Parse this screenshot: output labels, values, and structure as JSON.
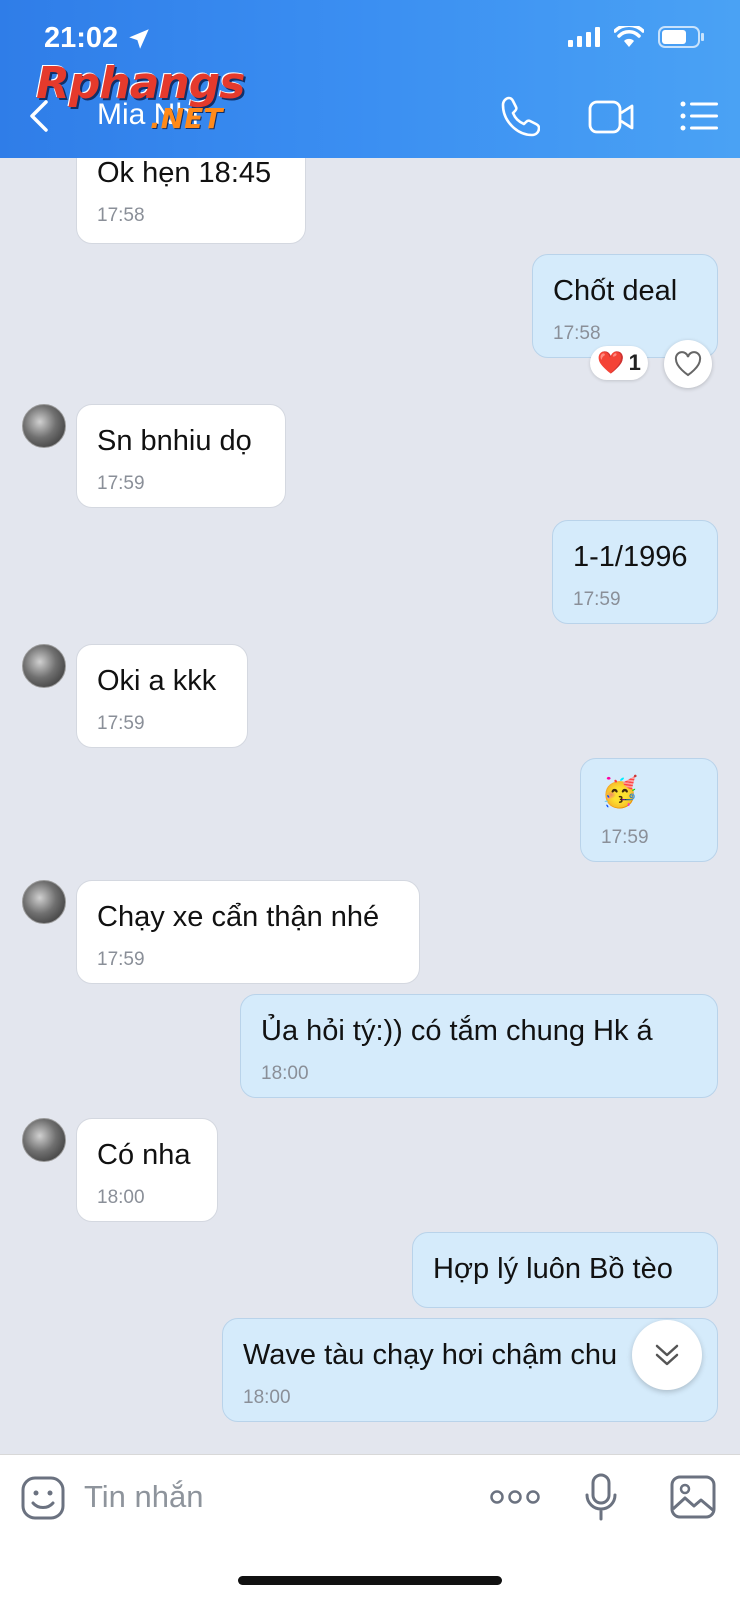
{
  "status_bar": {
    "time": "21:02"
  },
  "watermark": {
    "brand": "Rphangs",
    "domain": ".NET"
  },
  "header": {
    "contact_name": "Mia Nhi"
  },
  "messages": [
    {
      "dir": "in",
      "text": "Ok hẹn 18:45",
      "time": "17:58"
    },
    {
      "dir": "out",
      "text": "Chốt deal",
      "time": "17:58",
      "reaction": {
        "emoji": "❤️",
        "count": "1"
      }
    },
    {
      "dir": "in",
      "text": "Sn bnhiu dọ",
      "time": "17:59"
    },
    {
      "dir": "out",
      "text": "1-1/1996",
      "time": "17:59"
    },
    {
      "dir": "in",
      "text": "Oki a kkk",
      "time": "17:59"
    },
    {
      "dir": "out",
      "text": "🥳",
      "time": "17:59"
    },
    {
      "dir": "in",
      "text": "Chạy xe cẩn thận nhé",
      "time": "17:59"
    },
    {
      "dir": "out",
      "text": "Ủa hỏi tý:)) có tắm chung Hk á",
      "time": "18:00"
    },
    {
      "dir": "in",
      "text": "Có nha",
      "time": "18:00"
    },
    {
      "dir": "out",
      "text": "Hợp lý luôn Bồ tèo",
      "time": ""
    },
    {
      "dir": "out",
      "text": "Wave tàu chạy hơi chậm chu",
      "time": "18:00"
    }
  ],
  "input": {
    "placeholder": "Tin nhắn"
  },
  "icons": {
    "back": "chevron-left-icon",
    "call": "phone-icon",
    "video": "video-camera-icon",
    "menu": "list-menu-icon",
    "sticker": "sticker-icon",
    "more": "more-dots-icon",
    "mic": "microphone-icon",
    "gallery": "image-icon",
    "scroll": "double-chevron-down-icon",
    "like": "heart-icon"
  },
  "colors": {
    "header_start": "#2f7de8",
    "header_end": "#4aa2f4",
    "incoming_bubble": "#ffffff",
    "outgoing_bubble": "#d5ebfb",
    "chat_bg": "#e3e6ee"
  }
}
